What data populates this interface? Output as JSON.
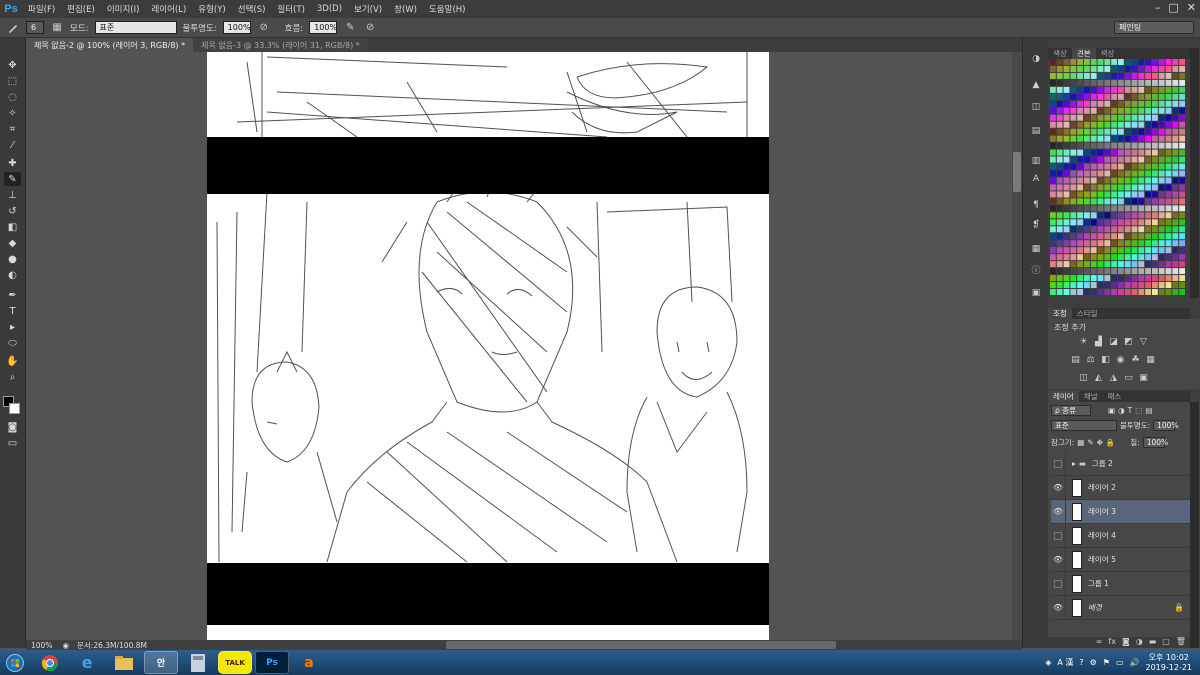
{
  "app": {
    "logo": "Ps"
  },
  "menu": [
    "파일(F)",
    "편집(E)",
    "이미지(I)",
    "레이어(L)",
    "유형(Y)",
    "선택(S)",
    "필터(T)",
    "3D(D)",
    "보기(V)",
    "창(W)",
    "도움말(H)"
  ],
  "window_controls": [
    "–",
    "□",
    "✕"
  ],
  "options": {
    "brush_size": "6",
    "mode_label": "모드:",
    "mode_value": "표준",
    "opacity_label": "불투명도:",
    "opacity_value": "100%",
    "flow_label": "흐름:",
    "flow_value": "100%",
    "workspace": "페인팅"
  },
  "tabs": [
    {
      "label": "제목 없음-2 @ 100% (레이어 3, RGB/8) *",
      "active": true
    },
    {
      "label": "제목 없음-3 @ 33.3% (레이어 31, RGB/8) *",
      "active": false
    }
  ],
  "status": {
    "zoom": "100%",
    "doc": "문서:26.3M/100.8M"
  },
  "panels": {
    "swatch_tabs": [
      "색상",
      "견본",
      "색상"
    ],
    "adjust_tabs": [
      "조정",
      "스타일"
    ],
    "adjust_title": "조정 추가",
    "layer_tabs": [
      "레이어",
      "채널",
      "패스"
    ],
    "kind_filter": "ρ 종류",
    "blend_mode": "표준",
    "opacity_label": "불투명도:",
    "opacity_value": "100%",
    "lock_label": "잠그기:",
    "fill_label": "칠:",
    "fill_value": "100%"
  },
  "layers": [
    {
      "name": "그룹 2",
      "visible": false,
      "group": true,
      "selected": false
    },
    {
      "name": "레이어 2",
      "visible": true,
      "group": false,
      "selected": false
    },
    {
      "name": "레이어 3",
      "visible": true,
      "group": false,
      "selected": true
    },
    {
      "name": "레이어 4",
      "visible": false,
      "group": false,
      "selected": false
    },
    {
      "name": "레이어 5",
      "visible": true,
      "group": false,
      "selected": false
    },
    {
      "name": "그룹 1",
      "visible": false,
      "group": false,
      "selected": false
    },
    {
      "name": "배경",
      "visible": true,
      "group": false,
      "selected": false,
      "locked": true
    }
  ],
  "taskbar": {
    "apps": [
      "chrome",
      "ie",
      "explorer",
      "안",
      "calc",
      "TALK",
      "Ps",
      "avast"
    ],
    "tray_lang": "A 漢",
    "time_ampm": "오후 10:02",
    "date": "2019-12-21"
  }
}
